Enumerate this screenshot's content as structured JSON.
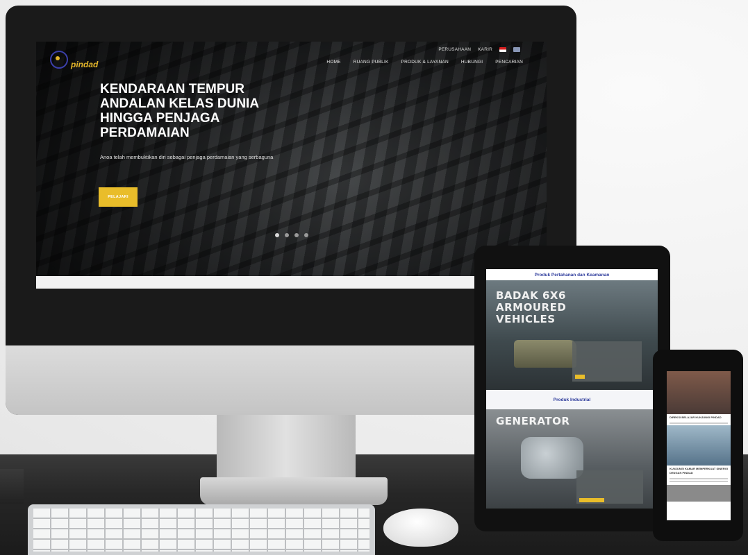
{
  "desktop": {
    "logo_text": "pindad",
    "topbar": {
      "link1": "PERUSAHAAN",
      "link2": "KARIR"
    },
    "nav": [
      "HOME",
      "RUANG PUBLIK",
      "PRODUK & LAYANAN",
      "HUBUNGI",
      "PENCARIAN"
    ],
    "hero": {
      "title_lines": [
        "KENDARAAN TEMPUR",
        "ANDALAN KELAS DUNIA",
        "HINGGA PENJAGA",
        "PERDAMAIAN"
      ],
      "subtitle": "Anoa telah membuktikan diri sebagai penjaga perdamaian yang serbaguna",
      "button": "PELAJARI"
    }
  },
  "tablet": {
    "section1_title": "Produk Pertahanan dan Keamanan",
    "banner1_lines": [
      "BADAK 6X6",
      "ARMOURED",
      "VEHICLES"
    ],
    "section2_title": "Produk Industrial",
    "banner2": "GENERATOR"
  },
  "phone": {
    "caption1": "DIREKSI BELAJAR KUNJUNGI PINDAD",
    "caption2": "KUNJUNGI KAMAR MEMPERKUAT SINERGI DENGAN PINDAD"
  }
}
